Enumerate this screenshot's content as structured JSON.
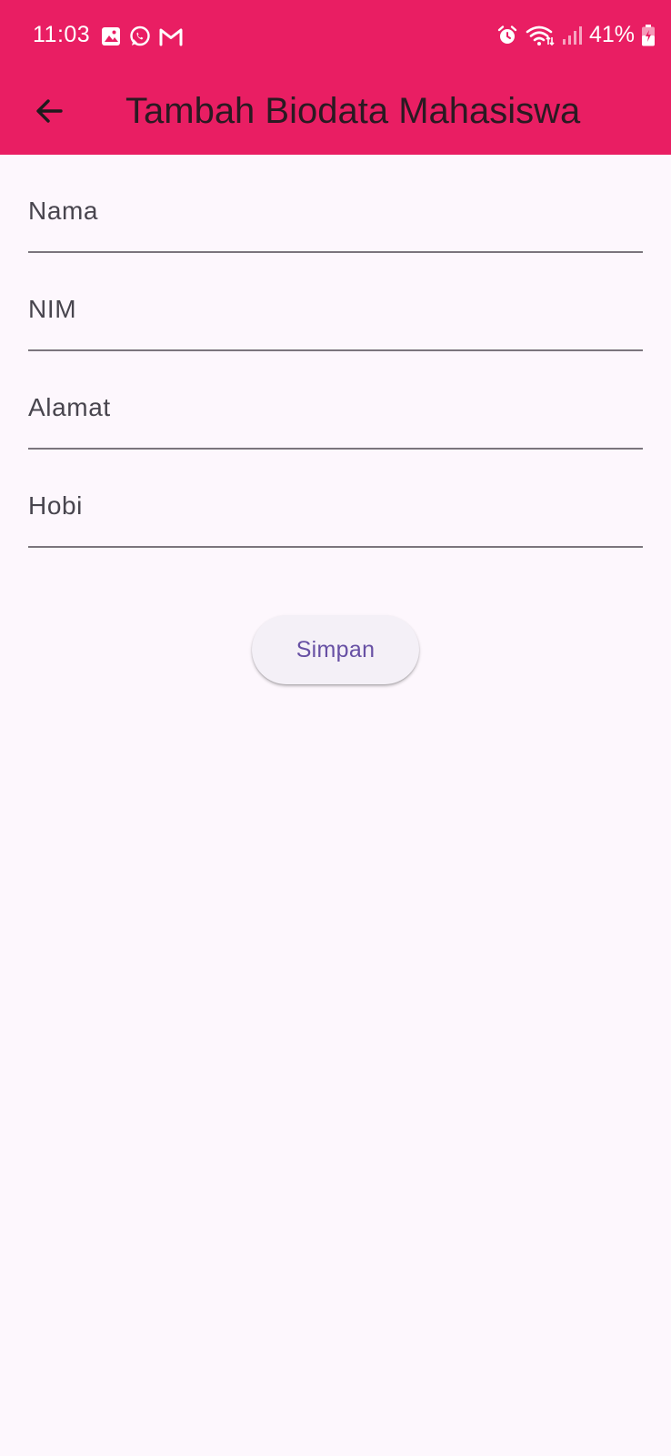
{
  "status_bar": {
    "time": "11:03",
    "battery": "41%",
    "left_icons": [
      "gallery-icon",
      "whatsapp-icon",
      "gmail-icon"
    ],
    "right_icons": [
      "alarm-icon",
      "wifi-icon",
      "signal-icon",
      "battery-charging-icon"
    ]
  },
  "app_bar": {
    "title": "Tambah Biodata Mahasiswa",
    "back_icon": "arrow-back-icon",
    "background": "#e91e63"
  },
  "form": {
    "fields": [
      {
        "label": "Nama",
        "value": ""
      },
      {
        "label": "NIM",
        "value": ""
      },
      {
        "label": "Alamat",
        "value": ""
      },
      {
        "label": "Hobi",
        "value": ""
      }
    ],
    "submit_label": "Simpan"
  },
  "colors": {
    "accent": "#e91e63",
    "button_text": "#6750a4",
    "background": "#fdf7fd"
  }
}
